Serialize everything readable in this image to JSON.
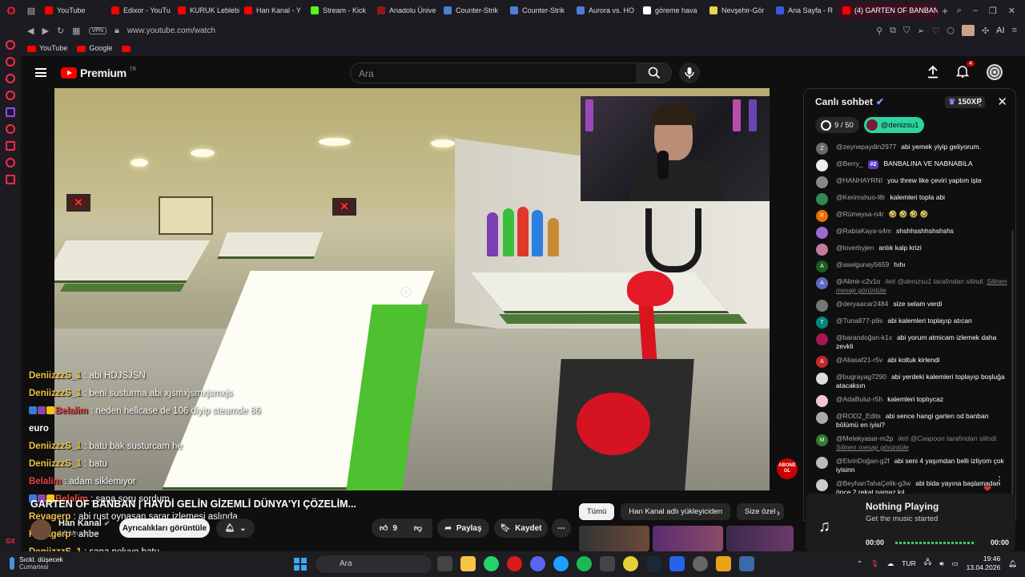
{
  "browser": {
    "tabs": [
      {
        "label": "YouTube",
        "color": "#ff0000"
      },
      {
        "label": "Edixor - YouTu",
        "color": "#ff0000"
      },
      {
        "label": "KURUK Leblebi",
        "color": "#ff0000"
      },
      {
        "label": "Han Kanal - Y",
        "color": "#ff0000"
      },
      {
        "label": "Stream - Kick",
        "color": "#53fc18"
      },
      {
        "label": "Anadolu Ünive",
        "color": "#8b1a1a"
      },
      {
        "label": "Counter-Strik",
        "color": "#4a7fd1"
      },
      {
        "label": "Counter-Strik",
        "color": "#4a7fd1"
      },
      {
        "label": "Aurora vs. HO",
        "color": "#4a7fd1"
      },
      {
        "label": "göreme hava",
        "color": "#ffffff"
      },
      {
        "label": "Nevşehir-Gör",
        "color": "#e8d34a"
      },
      {
        "label": "Ana Sayfa - R",
        "color": "#3a5ad9"
      }
    ],
    "active_tab": "(4) GARTEN OF BANBAN",
    "vpn": "VPN",
    "url": "www.youtube.com/watch",
    "ai_label": "AI",
    "bookmarks": [
      "YouTube",
      "Google"
    ]
  },
  "youtube": {
    "logo_text": "Premium",
    "logo_region": "TR",
    "search_placeholder": "Ara",
    "notif_count": "4"
  },
  "overlay_chat": [
    {
      "user": "DeniizzzS_1",
      "msg": ": abi HDJSJSN",
      "red": false,
      "badges": false
    },
    {
      "user": "DeniizzzS_1",
      "msg": ": beni susturma abi xjsmxjsmxjsmxjs",
      "red": false,
      "badges": false
    },
    {
      "user": "Belalim",
      "msg": ": neden hellcase de 106 diyip steamde 86",
      "red": true,
      "badges": true
    },
    {
      "user": "",
      "msg": "euro",
      "red": false,
      "badges": false
    },
    {
      "user": "DeniizzzS_1",
      "msg": ": batu bak susturcam he",
      "red": false,
      "badges": false
    },
    {
      "user": "DeniizzzS_1",
      "msg": ": batu",
      "red": false,
      "badges": false
    },
    {
      "user": "Belalim",
      "msg": ": adam siklemiyor",
      "red": true,
      "badges": false
    },
    {
      "user": "Belalim",
      "msg": ": sana soru sordum",
      "red": true,
      "badges": true
    },
    {
      "user": "Revagerp",
      "msg": ": abi rust oynasan sarar izlemesi aslında",
      "red": false,
      "badges": false
    },
    {
      "user": "Revagerp",
      "msg": ": ahbe",
      "red": false,
      "badges": false
    },
    {
      "user": "DeniizzzS_1",
      "msg": ": sana noluyo batu",
      "red": false,
      "badges": false
    }
  ],
  "video": {
    "title": "GARTEN OF BANBAN | HAYDİ GELİN GİZEMLİ DÜNYA'YI ÇÖZELİM...",
    "channel": "Han Kanal",
    "subs": "1,3 Mn abone",
    "abone_badge": "ABONE OL",
    "join_label": "Ayrıcalıkları görüntüle",
    "likes": "9",
    "share_label": "Paylaş",
    "save_label": "Kaydet"
  },
  "rec_tabs": [
    "Tümü",
    "Han Kanal adlı yükleyiciden",
    "Size özel"
  ],
  "chat": {
    "title": "Canlı sohbet",
    "xp": "150XP",
    "goal": "9 / 50",
    "pinned_user": "@denizsu1",
    "messages": [
      {
        "author": "@zeynepaydin2977",
        "text": "abi yemek yiyip geliyorum.",
        "av": "Z",
        "color": "#6b6b6b"
      },
      {
        "author": "@Berry_",
        "text": "BANBALINA VE NABNABILA",
        "av": "",
        "color": "#eeeeee",
        "rank": "#2"
      },
      {
        "author": "@HANHAYRNI",
        "text": "you threw like çeviri yaptım işte",
        "av": "",
        "color": "#888888"
      },
      {
        "author": "@Kerimshuo-l8r",
        "text": "kalemleri topla abi",
        "av": "",
        "color": "#2e8b57"
      },
      {
        "author": "@Rümeysa-n4r",
        "text": "🤣 🤣 🤣 🤣",
        "av": "R",
        "color": "#ef6c00"
      },
      {
        "author": "@RabiaKaya-s4m",
        "text": "shshhsshhshshshs",
        "av": "",
        "color": "#9c6ad1"
      },
      {
        "author": "@loverbyjen",
        "text": "anlık kalp krizi",
        "av": "",
        "color": "#c27ba0"
      },
      {
        "author": "@aselgunay5659",
        "text": "hıhı",
        "av": "A",
        "color": "#1b5e20"
      },
      {
        "author": "@Alimir-c2v1o",
        "text": "",
        "deleted": "ileti @denizsu1 tarafından silindi.",
        "link": "Silinen mesajı görüntüle",
        "av": "A",
        "color": "#5c6bc0"
      },
      {
        "author": "@deryaacar2484",
        "text": "size selam verdi",
        "av": "",
        "color": "#777777"
      },
      {
        "author": "@Tuna877-p9s",
        "text": "abi kalemleri toplayıp atıcan",
        "av": "T",
        "color": "#00897b"
      },
      {
        "author": "@barandoğan-k1x",
        "text": "abi yorum atmicam izlemek daha zevkli",
        "av": "",
        "color": "#ad1457"
      },
      {
        "author": "@Aliasaf21-r5v",
        "text": "abi koltuk kirlendi",
        "av": "A",
        "color": "#c62828"
      },
      {
        "author": "@bugrayag7290",
        "text": "abi yerdeki kalemleri toplayıp boşluğa atacaksın",
        "av": "",
        "color": "#dddddd"
      },
      {
        "author": "@AdaBulut-r5h",
        "text": "kalemleri toplıycaz",
        "av": "",
        "color": "#f3c4d7"
      },
      {
        "author": "@ROD2_Edits",
        "text": "abi sence hangi garten od banban bölümü en iyisi?",
        "av": "",
        "color": "#aaaaaa"
      },
      {
        "author": "@Melekyasar-m2p",
        "text": "",
        "deleted": "ileti @Caapoon tarafından silindi.",
        "link": "Silinen mesajı görüntüle",
        "av": "M",
        "color": "#2e7d32"
      },
      {
        "author": "@ElvinDoğan-g2f",
        "text": "abi seni 4 yaşımdan belli izliyom çok iyisinn",
        "av": "",
        "color": "#bbbbbb"
      },
      {
        "author": "@BeyhanTahaÇelik-g3w",
        "text": "abi bida yayına başlamadan önce 2 rekat namaz kıl",
        "av": "",
        "color": "#cccccc"
      }
    ]
  },
  "music": {
    "now_playing": "Nothing Playing",
    "sub": "Get the music started",
    "time_start": "00:00",
    "time_end": "00:00"
  },
  "taskbar": {
    "weather_line1": "Sıckl. düşecek",
    "weather_line2": "Cumartesi",
    "search": "Ara",
    "lang": "TUR",
    "time": "19:46",
    "date": "13.04.2026"
  }
}
